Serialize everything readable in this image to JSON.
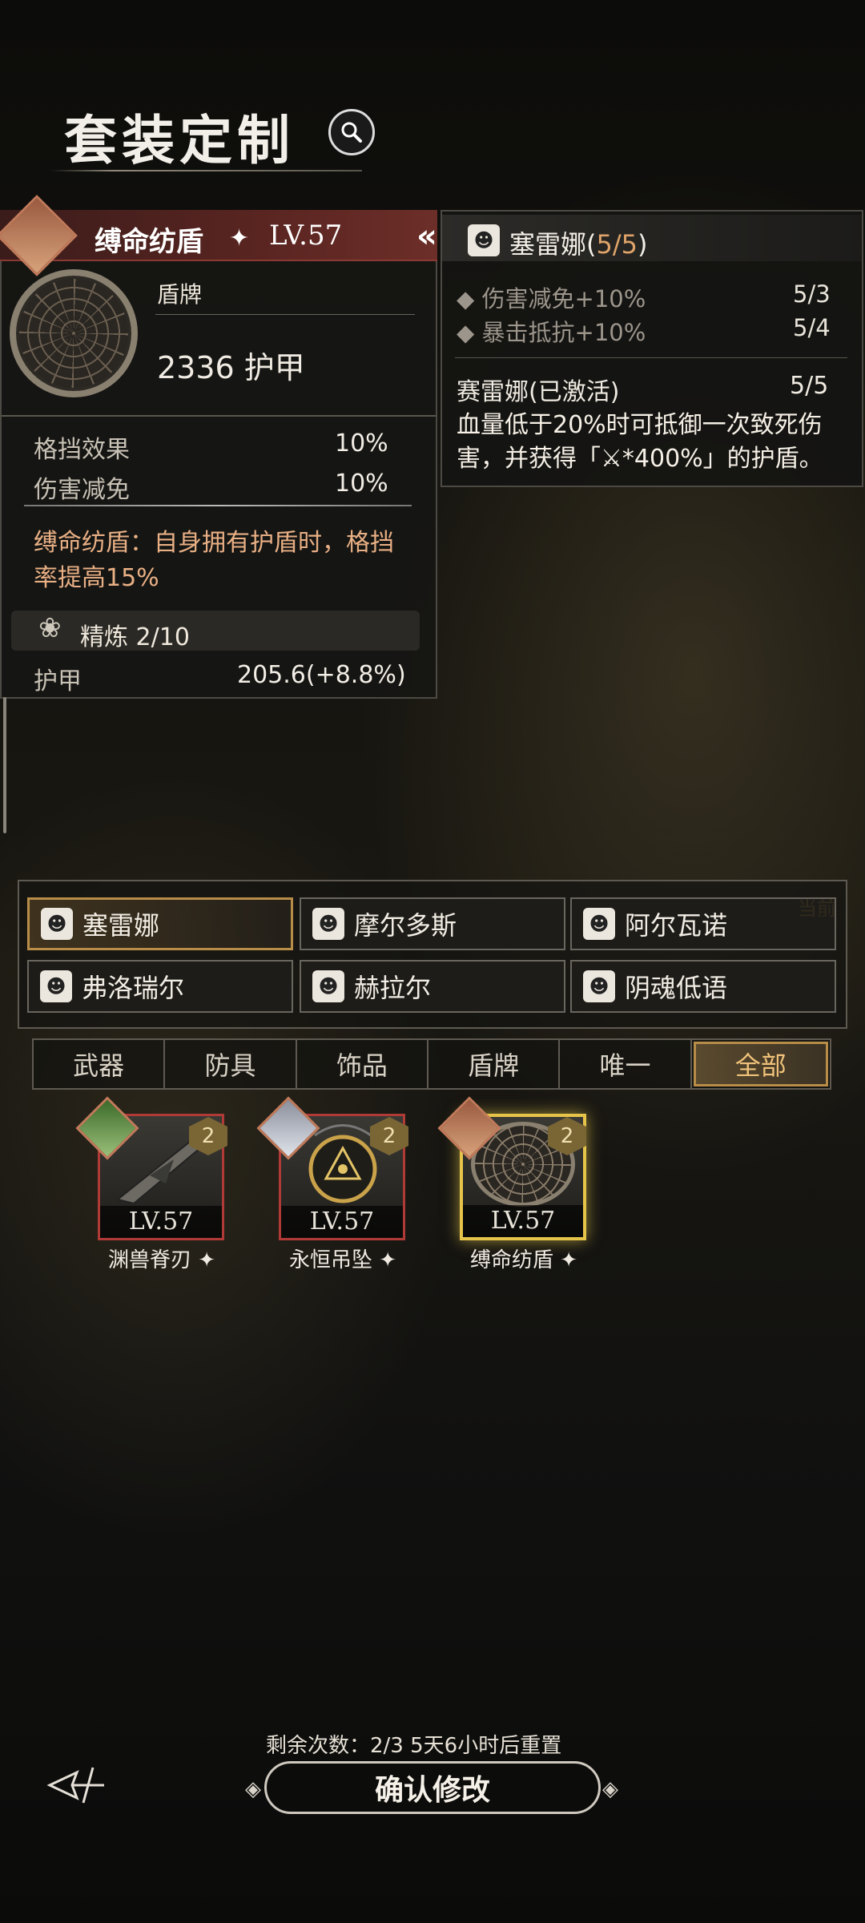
{
  "header": {
    "title": "套装定制"
  },
  "item": {
    "name": "缚命纺盾",
    "star": "✦",
    "level": "LV.57",
    "type": "盾牌",
    "armor": "2336 护甲",
    "stats": [
      {
        "label": "格挡效果",
        "value": "10%"
      },
      {
        "label": "伤害减免",
        "value": "10%"
      }
    ],
    "desc": "缚命纺盾：自身拥有护盾时，格挡率提高15%",
    "refine": "精炼 2/10",
    "armor_label": "护甲",
    "armor_bonus": "205.6(+8.8%)"
  },
  "set": {
    "name": "塞雷娜(",
    "count": "5/5",
    "close": ")",
    "bonuses": [
      {
        "label": "伤害减免+10%",
        "value": "5/3"
      },
      {
        "label": "暴击抵抗+10%",
        "value": "5/4"
      }
    ],
    "active_label": "赛雷娜(已激活)",
    "active_value": "5/5",
    "active_desc": "血量低于20%时可抵御一次致死伤害，并获得「⚔*400%」的护盾。"
  },
  "characters": [
    {
      "label": "塞雷娜"
    },
    {
      "label": "摩尔多斯"
    },
    {
      "label": "阿尔瓦诺"
    },
    {
      "label": "弗洛瑞尔"
    },
    {
      "label": "赫拉尔"
    },
    {
      "label": "阴魂低语"
    }
  ],
  "current_tag": "当前",
  "tabs": [
    {
      "label": "武器"
    },
    {
      "label": "防具"
    },
    {
      "label": "饰品"
    },
    {
      "label": "盾牌"
    },
    {
      "label": "唯一"
    },
    {
      "label": "全部"
    }
  ],
  "items": [
    {
      "name": "渊兽脊刃",
      "level": "LV.57",
      "badge": "2"
    },
    {
      "name": "永恒吊坠",
      "level": "LV.57",
      "badge": "2"
    },
    {
      "name": "缚命纺盾",
      "level": "LV.57",
      "badge": "2"
    }
  ],
  "footer": {
    "remain": "剩余次数：2/3   5天6小时后重置",
    "confirm": "确认修改"
  },
  "colors": {
    "accent": "#e0a36a",
    "selected_border": "#e6c44a",
    "card_border": "#b03a36"
  }
}
